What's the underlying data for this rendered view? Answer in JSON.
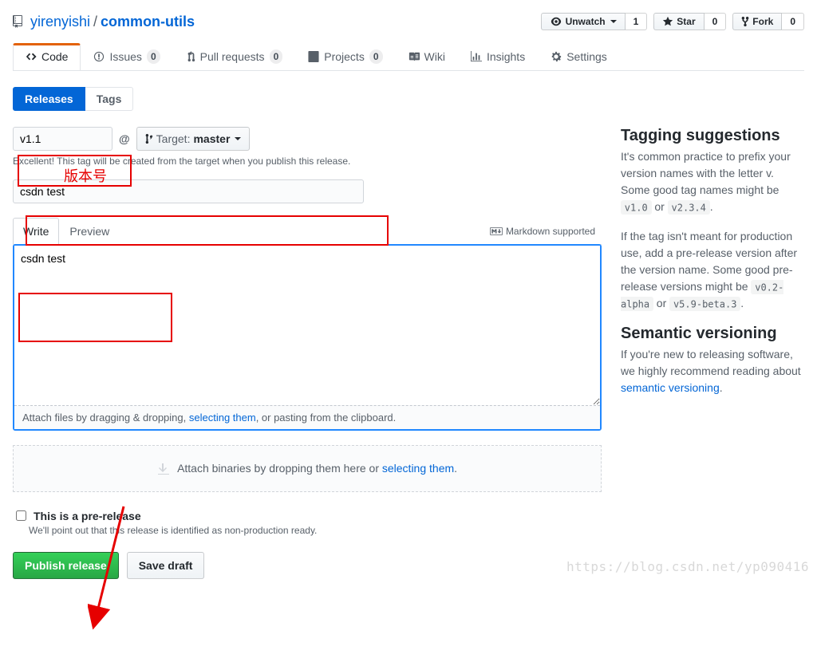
{
  "repo": {
    "owner": "yirenyishi",
    "name": "common-utils",
    "sep": "/"
  },
  "actions": {
    "unwatch": "Unwatch",
    "unwatch_count": "1",
    "star": "Star",
    "star_count": "0",
    "fork": "Fork",
    "fork_count": "0"
  },
  "nav": {
    "code": "Code",
    "issues": "Issues",
    "issues_count": "0",
    "pulls": "Pull requests",
    "pulls_count": "0",
    "projects": "Projects",
    "projects_count": "0",
    "wiki": "Wiki",
    "insights": "Insights",
    "settings": "Settings"
  },
  "subnav": {
    "releases": "Releases",
    "tags": "Tags"
  },
  "form": {
    "tag_value": "v1.1",
    "at": "@",
    "target_label": "Target:",
    "target_value": "master",
    "tag_note": "Excellent! This tag will be created from the target when you publish this release.",
    "title_value": "csdn test",
    "body_value": "csdn test",
    "write_tab": "Write",
    "preview_tab": "Preview",
    "md_hint": "Markdown supported",
    "attach_pre": "Attach files by dragging & dropping, ",
    "attach_link": "selecting them",
    "attach_post": ", or pasting from the clipboard.",
    "bin_pre": "Attach binaries by dropping them here or ",
    "bin_link": "selecting them",
    "bin_post": ".",
    "prerelease_label": "This is a pre-release",
    "prerelease_help": "We'll point out that this release is identified as non-production ready.",
    "publish": "Publish release",
    "save_draft": "Save draft"
  },
  "sidebar": {
    "h1": "Tagging suggestions",
    "p1a": "It's common practice to prefix your version names with the letter v. Some good tag names might be ",
    "p1_code1": "v1.0",
    "p1_mid": " or ",
    "p1_code2": "v2.3.4",
    "p1_end": ".",
    "p2a": "If the tag isn't meant for production use, add a pre-release version after the version name. Some good pre-release versions might be ",
    "p2_code1": "v0.2-alpha",
    "p2_mid": " or ",
    "p2_code2": "v5.9-beta.3",
    "p2_end": ".",
    "h2": "Semantic versioning",
    "p3a": "If you're new to releasing software, we highly recommend reading about ",
    "p3_link": "semantic versioning",
    "p3_end": "."
  },
  "annotation": {
    "version_label": "版本号"
  },
  "watermark": "https://blog.csdn.net/yp090416"
}
